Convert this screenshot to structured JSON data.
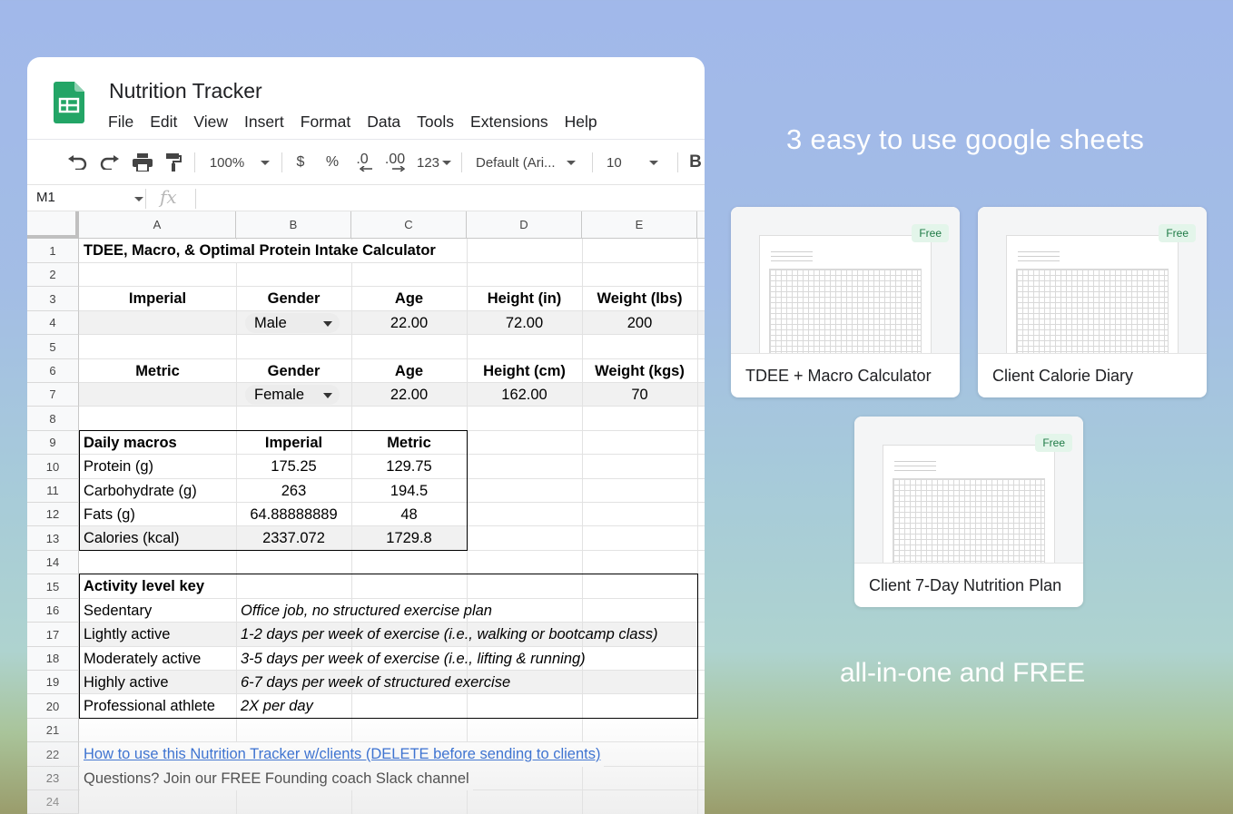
{
  "app": {
    "title": "Nutrition Tracker",
    "menu": [
      "File",
      "Edit",
      "View",
      "Insert",
      "Format",
      "Data",
      "Tools",
      "Extensions",
      "Help"
    ]
  },
  "toolbar": {
    "zoom": "100%",
    "currency": "$",
    "percent": "%",
    "decrease_decimals": ".0",
    "increase_decimals": ".00",
    "number_format": "123",
    "font": "Default (Ari...",
    "font_size": "10",
    "bold": "B"
  },
  "formula_bar": {
    "cell_ref": "M1",
    "fx": "fx"
  },
  "columns": [
    "A",
    "B",
    "C",
    "D",
    "E"
  ],
  "rows": [
    "1",
    "2",
    "3",
    "4",
    "5",
    "6",
    "7",
    "8",
    "9",
    "10",
    "11",
    "12",
    "13",
    "14",
    "15",
    "16",
    "17",
    "18",
    "19",
    "20",
    "21",
    "22",
    "23",
    "24"
  ],
  "sheet": {
    "title": "TDEE, Macro, & Optimal Protein Intake Calculator",
    "imperial": {
      "label": "Imperial",
      "gender_h": "Gender",
      "age_h": "Age",
      "height_h": "Height (in)",
      "weight_h": "Weight (lbs)",
      "gender": "Male",
      "age": "22.00",
      "height": "72.00",
      "weight": "200"
    },
    "metric": {
      "label": "Metric",
      "gender_h": "Gender",
      "age_h": "Age",
      "height_h": "Height (cm)",
      "weight_h": "Weight (kgs)",
      "gender": "Female",
      "age": "22.00",
      "height": "162.00",
      "weight": "70"
    },
    "macros": {
      "header": [
        "Daily macros",
        "Imperial",
        "Metric"
      ],
      "rows": [
        [
          "Protein (g)",
          "175.25",
          "129.75"
        ],
        [
          "Carbohydrate (g)",
          "263",
          "194.5"
        ],
        [
          "Fats (g)",
          "64.88888889",
          "48"
        ],
        [
          "Calories (kcal)",
          "2337.072",
          "1729.8"
        ]
      ]
    },
    "activity": {
      "header": "Activity level key",
      "rows": [
        [
          "Sedentary",
          "Office job, no structured exercise plan"
        ],
        [
          "Lightly active",
          "1-2 days per week of exercise (i.e., walking or bootcamp class)"
        ],
        [
          "Moderately active",
          "3-5 days per week of exercise (i.e., lifting & running)"
        ],
        [
          "Highly active",
          "6-7 days per week of structured exercise"
        ],
        [
          "Professional athlete",
          "2X per day"
        ]
      ]
    },
    "link": "How to use this Nutrition Tracker w/clients (DELETE before sending to clients)",
    "questions": "Questions? Join our FREE Founding coach Slack channel"
  },
  "promo": {
    "headline": "3 easy to use google sheets",
    "tagline": "all-in-one and FREE",
    "cards": [
      {
        "title": "TDEE + Macro Calculator",
        "badge": "Free"
      },
      {
        "title": "Client Calorie Diary",
        "badge": "Free"
      },
      {
        "title": "Client 7-Day Nutrition Plan",
        "badge": "Free"
      }
    ]
  },
  "colors": {
    "sheets_green": "#23a566",
    "link_blue": "#1155cc",
    "badge_bg": "#e3f5ea",
    "badge_text": "#1e7a45"
  }
}
